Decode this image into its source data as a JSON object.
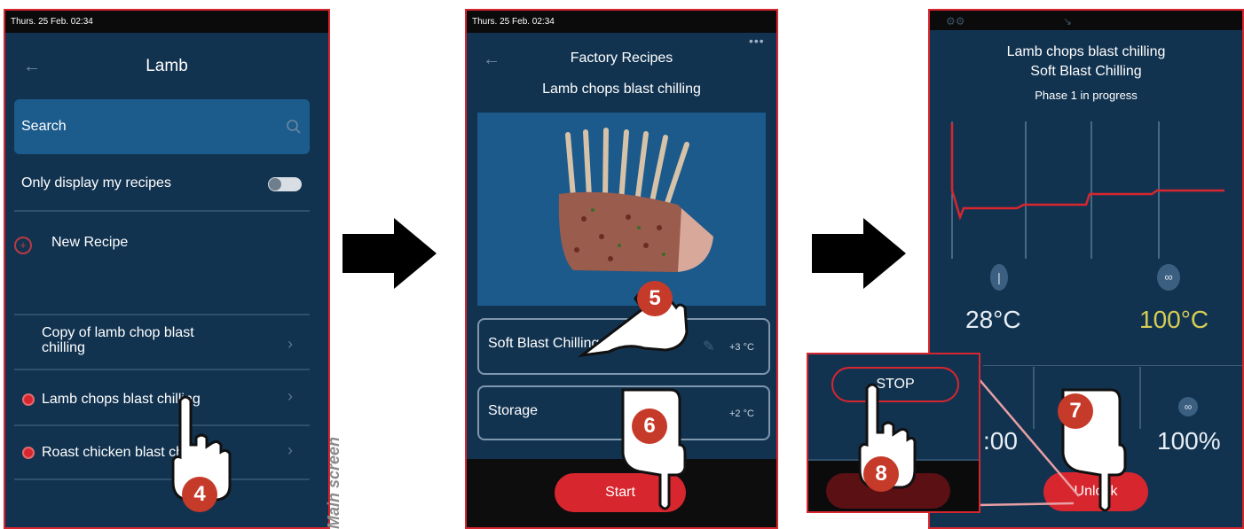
{
  "side_label": "Main screen",
  "screen1": {
    "status": "Thurs. 25 Feb. 02:34",
    "title": "Lamb",
    "search_placeholder": "Search",
    "toggle_label": "Only display my recipes",
    "new_recipe": "New Recipe",
    "recipes": [
      {
        "name": "Copy of lamb chop blast chilling"
      },
      {
        "name": "Lamb chops blast chilling"
      },
      {
        "name": "Roast chicken blast chilling"
      }
    ],
    "step_badge": "4"
  },
  "screen2": {
    "status": "Thurs. 25 Feb. 02:34",
    "title": "Factory Recipes",
    "subtitle": "Lamb chops blast chilling",
    "phases": [
      {
        "label": "Soft Blast Chilling",
        "temp": "+3 °C"
      },
      {
        "label": "Storage",
        "temp": "+2 °C"
      }
    ],
    "start_label": "Start",
    "step_badge_a": "5",
    "step_badge_b": "6"
  },
  "screen3": {
    "title": "Lamb chops blast chilling",
    "subtitle": "Soft Blast Chilling",
    "phase": "Phase 1 in progress",
    "core_temp": "28°C",
    "humidity": "100°C",
    "time_fragment": ":00",
    "fan": "100%",
    "unlock_label": "Unlock",
    "stop_label": "STOP",
    "step_badge_a": "7",
    "step_badge_b": "8"
  },
  "colors": {
    "screen_bg": "#123350",
    "accent_red": "#d8262f",
    "badge": "#c63a2a"
  }
}
